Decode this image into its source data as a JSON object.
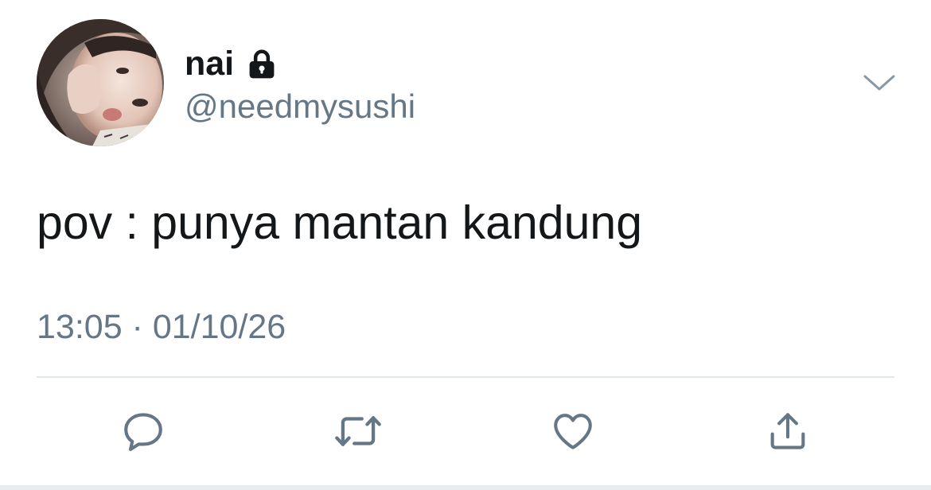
{
  "tweet": {
    "display_name": "nai",
    "handle": "@needmysushi",
    "protected": true,
    "text": "pov : punya mantan kandung",
    "timestamp": "13:05 · 01/10/26"
  },
  "icons": {
    "lock": "lock-icon",
    "caret": "chevron-down-icon",
    "reply": "reply-icon",
    "retweet": "retweet-icon",
    "like": "heart-icon",
    "share": "share-icon"
  },
  "colors": {
    "primary_text": "#14171a",
    "secondary_text": "#657786",
    "divider": "#e1e8ed",
    "icon": "#657786",
    "background": "#ffffff"
  }
}
